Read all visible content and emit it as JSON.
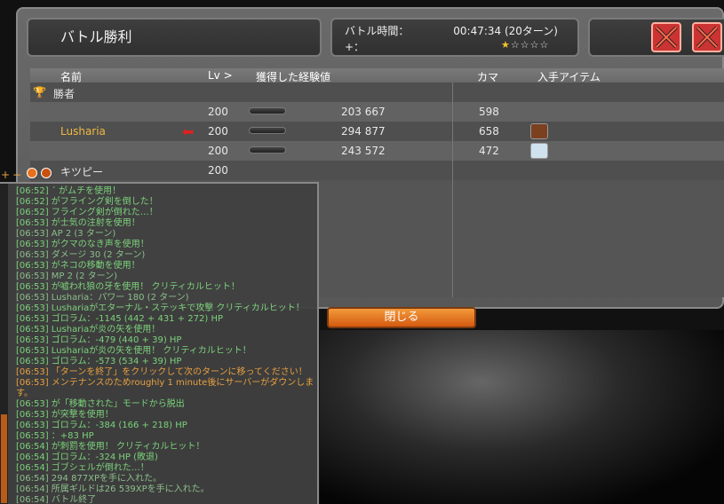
{
  "window": {
    "title": "バトル勝利",
    "battle_time_label": "バトル時間：",
    "battle_time_value": "00:47:34 (20ターン)",
    "plus_label": "+：",
    "stars_filled": "★",
    "stars_empty": "☆☆☆☆"
  },
  "table": {
    "headers": {
      "name": "名前",
      "lv": "Lv >",
      "xp": "獲得した経験値",
      "kama": "カマ",
      "items": "入手アイテム"
    },
    "winner_label": "勝者",
    "rows": [
      {
        "name": "",
        "lv": "200",
        "xp": "203 667",
        "kama": "598"
      },
      {
        "name": "Lusharia",
        "lv": "200",
        "xp": "294 877",
        "kama": "658"
      },
      {
        "name": "",
        "lv": "200",
        "xp": "243 572",
        "kama": "472"
      },
      {
        "name": "キツピー",
        "lv": "200",
        "xp": "",
        "kama": ""
      }
    ]
  },
  "close_button": "閉じる",
  "chat": {
    "controls": [
      "+",
      "−"
    ],
    "lines": [
      "[06:52]        ´  がムチを使用！",
      "[06:52]           がフライング剣を倒した！",
      "[06:52] フライング剣が倒れた…！",
      "[06:53]              が士気の注射を使用！",
      "[06:53]              AP 2 (3 ターン)",
      "[06:53]              がクマのなき声を使用！",
      "[06:53]              ダメージ 30 (2 ターン)",
      "[06:53]              がネコの移動を使用！",
      "[06:53]              MP 2 (2 ターン)",
      "[06:53]              が嘘われ狼の牙を使用！ クリティカルヒット！",
      "[06:53] Lusharia：パワー 180 (2 ターン)",
      "[06:53] Lushariaがエターナル・ステッキで攻撃 クリティカルヒット！",
      "[06:53] ゴロラム：-1145 (442 + 431 + 272) HP",
      "[06:53] Lushariaが炎の矢を使用！",
      "[06:53] ゴロラム：-479 (440 + 39) HP",
      "[06:53] Lushariaが炎の矢を使用！ クリティカルヒット！",
      "[06:53] ゴロラム：-573 (534 + 39) HP",
      "[06:53] 「ターンを終了」をクリックして次のターンに移ってください！",
      "[06:53] メンテナンスのためroughly 1 minute後にサーバーがダウンします。",
      "[06:53]            が「移動された」モードから脱出",
      "[06:53]            が突撃を使用！",
      "[06:53] ゴロラム：-384 (166 + 218) HP",
      "[06:53]            ：+83 HP",
      "[06:54]              が刺罰を使用！ クリティカルヒット！",
      "[06:54] ゴロラム：-324 HP (敗退)",
      "[06:54] ゴブシェルが倒れた…！",
      "[06:54] 294 877XPを手に入れた。",
      "[06:54] 所属ギルドは26 539XPを手に入れた。",
      "[06:54] バトル終了"
    ]
  },
  "colors": {
    "accent_orange": "#e8701a",
    "chat_green": "#7cd27c",
    "warn_orange": "#e8a040",
    "close_red": "#cc3333"
  },
  "icons": [
    "trophy-icon",
    "red-arrow-icon",
    "boot-item-icon",
    "crystal-item-icon",
    "close-x-icon"
  ]
}
